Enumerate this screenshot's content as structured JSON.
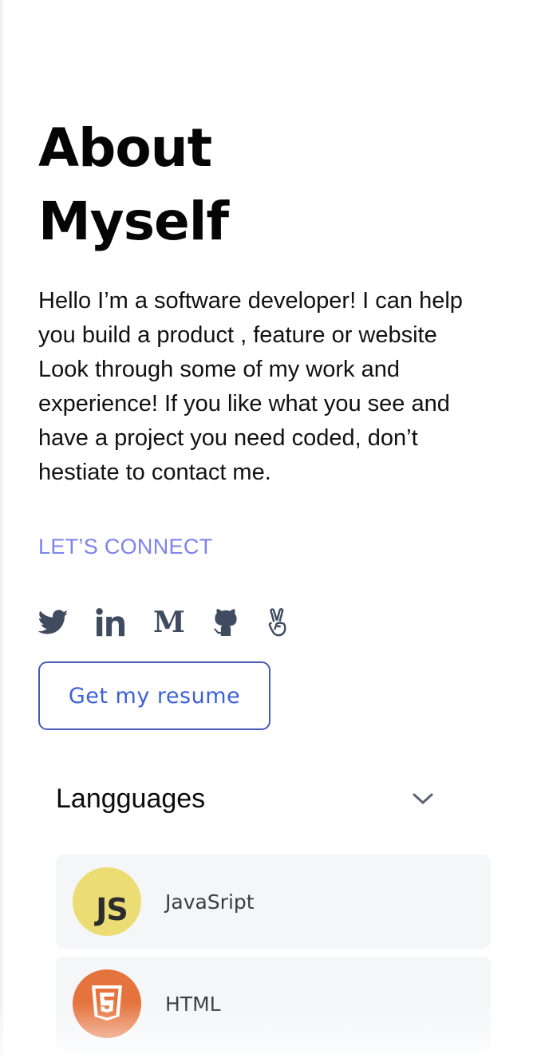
{
  "about": {
    "title_lines": [
      "About",
      "Myself"
    ],
    "bio_lines": [
      "Hello I’m a software developer! I can help",
      "you build a product , feature or website",
      "Look through some of my work and",
      "experience! If you like what you see and",
      "have a project you need coded, don’t",
      "hestiate to contact me."
    ]
  },
  "connect": {
    "label": "LET’S CONNECT",
    "social_links": [
      {
        "icon": "twitter-icon"
      },
      {
        "icon": "linkedin-icon"
      },
      {
        "icon": "medium-icon",
        "glyph": "M"
      },
      {
        "icon": "github-icon"
      },
      {
        "icon": "angellist-icon"
      }
    ],
    "resume_button_label": "Get my resume"
  },
  "skills": {
    "section_title": "Langguages",
    "expanded": true,
    "items": [
      {
        "name": "JavaSript",
        "logo_icon": "javascript-icon",
        "logo_text": "JS",
        "logo_color": "#ebdd74"
      },
      {
        "name": "HTML",
        "logo_icon": "html5-icon",
        "logo_text": "5",
        "logo_color": "#e5733d"
      }
    ]
  },
  "colors": {
    "accent_label": "#7d83ec",
    "button_border": "#4b5bb8",
    "button_text": "#3e61d6",
    "icon": "#3f4b5e",
    "card_bg": "#f5f6f8"
  }
}
